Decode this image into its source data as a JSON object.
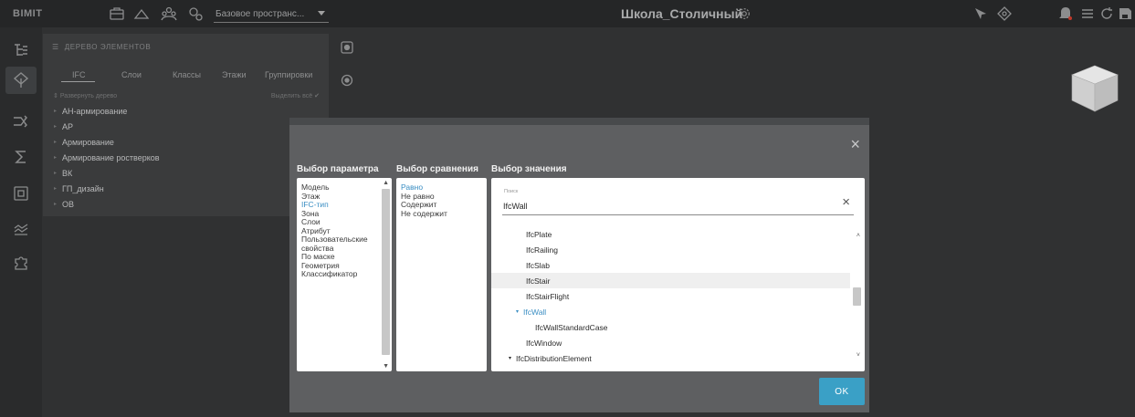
{
  "topbar": {
    "logo": "BIMIT",
    "space_select": "Базовое пространс...",
    "project_title": "Школа_Столичный"
  },
  "tree_panel": {
    "title": "ДЕРЕВО ЭЛЕМЕНТОВ",
    "tabs": [
      "IFC",
      "Слои",
      "Классы",
      "Этажи",
      "Группировки"
    ],
    "expand_label": "Развернуть дерево",
    "select_all_label": "Выделить всё",
    "items": [
      "АН-армирование",
      "АР",
      "Армирование",
      "Армирование ростверков",
      "ВК",
      "ГП_дизайн",
      "ОВ"
    ]
  },
  "modal": {
    "close": "×",
    "param_heading": "Выбор параметра",
    "compare_heading": "Выбор сравнения",
    "value_heading": "Выбор значения",
    "params": [
      "Модель",
      "Этаж",
      "IFC-тип",
      "Зона",
      "Слои",
      "Атрибут",
      "Пользовательские",
      "свойства",
      "По маске",
      "Геометрия",
      "Классификатор"
    ],
    "params_selected_index": 2,
    "comparisons": [
      "Равно",
      "Не равно",
      "Содержит",
      "Не содержит"
    ],
    "comparison_selected_index": 0,
    "search_label": "Поиск",
    "search_value": "IfcWall",
    "clear": "×",
    "values": [
      "IfcPlate",
      "IfcRailing",
      "IfcSlab",
      "IfcStair",
      "IfcStairFlight",
      "IfcWall",
      "IfcWallStandardCase",
      "IfcWindow",
      "IfcDistributionElement"
    ],
    "ok_label": "OK"
  },
  "icons": {
    "accent": "#3aa0c6",
    "selection_color": "#3a8ec3"
  }
}
